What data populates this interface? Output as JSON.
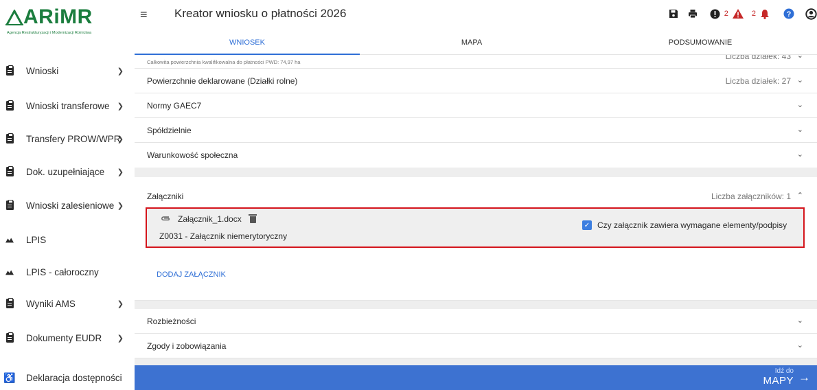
{
  "logo": {
    "name": "ARiMR",
    "subtitle": "Agencja Restrukturyzacji i Modernizacji Rolnictwa"
  },
  "header": {
    "title": "Kreator wniosku o płatności 2026",
    "icons": [
      "save-icon",
      "print-icon",
      "error-icon",
      "warning-icon",
      "bell-icon",
      "help-icon",
      "account-icon"
    ],
    "warning_count": "2",
    "notification_count": "2",
    "colors": {
      "error": "#c62828",
      "help": "#2f6fd6"
    }
  },
  "tabs": [
    {
      "label": "WNIOSEK",
      "active": true
    },
    {
      "label": "MAPA",
      "active": false
    },
    {
      "label": "PODSUMOWANIE",
      "active": false
    }
  ],
  "sidebar": {
    "items": [
      {
        "label": "Wnioski",
        "icon": "clipboard-icon",
        "expandable": true
      },
      {
        "label": "Wnioski transferowe",
        "icon": "clipboard-icon",
        "expandable": true
      },
      {
        "label": "Transfery PROW/WPR",
        "icon": "clipboard-icon",
        "expandable": true
      },
      {
        "label": "Dok. uzupełniające",
        "icon": "clipboard-icon",
        "expandable": true
      },
      {
        "label": "Wnioski zalesieniowe",
        "icon": "clipboard-icon",
        "expandable": true
      },
      {
        "label": "LPIS",
        "icon": "mountain-icon",
        "expandable": false
      },
      {
        "label": "LPIS - całoroczny",
        "icon": "mountain-icon",
        "expandable": false
      },
      {
        "label": "Wyniki AMS",
        "icon": "clipboard-icon",
        "expandable": true
      },
      {
        "label": "Dokumenty EUDR",
        "icon": "clipboard-icon",
        "expandable": true
      },
      {
        "label": "Deklaracja dostępności",
        "icon": "accessibility-icon",
        "expandable": false
      }
    ]
  },
  "main": {
    "top_partial": {
      "subtitle": "Całkowita powierzchnia kwalifikowalna do płatności PWD: 74,97 ha",
      "meta": "Liczba działek: 43"
    },
    "sections": [
      {
        "title": "Powierzchnie deklarowane (Działki rolne)",
        "meta": "Liczba działek: 27"
      },
      {
        "title": "Normy GAEC7",
        "meta": ""
      },
      {
        "title": "Spółdzielnie",
        "meta": ""
      },
      {
        "title": "Warunkowość społeczna",
        "meta": ""
      }
    ],
    "attachments": {
      "title": "Załączniki",
      "meta": "Liczba załączników: 1",
      "file": {
        "name": "Załącznik_1.docx",
        "description": "Z0031 - Załącznik niemerytoryczny",
        "checkbox_label": "Czy załącznik zawiera wymagane elementy/podpisy",
        "checked": true
      },
      "add_label": "DODAJ ZAŁĄCZNIK"
    },
    "sections_bottom": [
      {
        "title": "Rozbieżności",
        "meta": ""
      },
      {
        "title": "Zgody i zobowiązania",
        "meta": ""
      }
    ]
  },
  "footer": {
    "small": "Idź do",
    "large": "MAPY"
  }
}
